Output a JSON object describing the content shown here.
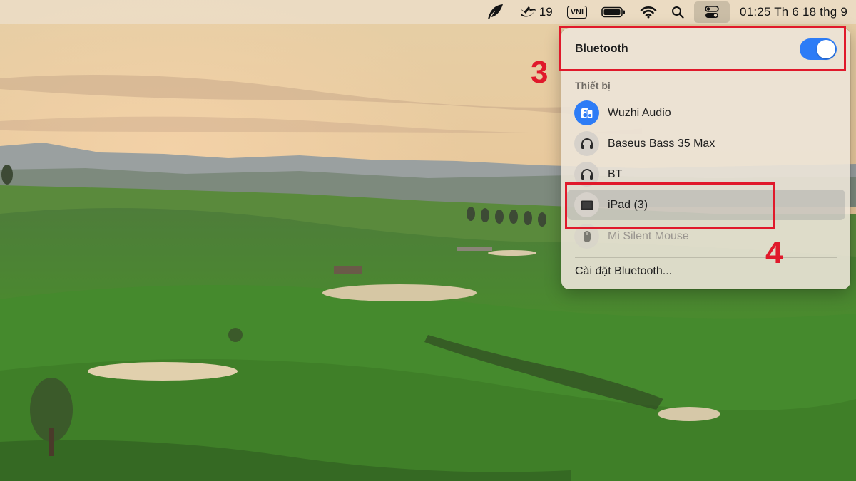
{
  "menubar": {
    "items": [
      {
        "icon": "quill-icon"
      },
      {
        "icon": "app-badge-icon",
        "count": "19"
      },
      {
        "icon": "input-method-icon",
        "label": "VNI"
      },
      {
        "icon": "battery-icon"
      },
      {
        "icon": "wifi-icon"
      },
      {
        "icon": "search-icon"
      },
      {
        "icon": "control-center-icon"
      }
    ],
    "clock": "01:25 Th 6 18 thg 9"
  },
  "bluetooth_panel": {
    "title": "Bluetooth",
    "toggle_on": true,
    "section_label": "Thiết bị",
    "devices": [
      {
        "label": "Wuzhi Audio",
        "icon": "bluetooth-audio-icon",
        "state": "connected"
      },
      {
        "label": "Baseus Bass 35 Max",
        "icon": "headphones-icon",
        "state": "normal"
      },
      {
        "label": "BT",
        "icon": "headphones-icon",
        "state": "normal"
      },
      {
        "label": "iPad (3)",
        "icon": "ipad-icon",
        "state": "highlighted"
      },
      {
        "label": "Mi Silent Mouse",
        "icon": "mouse-icon",
        "state": "disabled"
      }
    ],
    "settings_label": "Cài đặt Bluetooth..."
  },
  "annotations": [
    {
      "number": "3"
    },
    {
      "number": "4"
    }
  ],
  "colors": {
    "accent_blue": "#2d7cf6",
    "annotation_red": "#e0192b"
  }
}
